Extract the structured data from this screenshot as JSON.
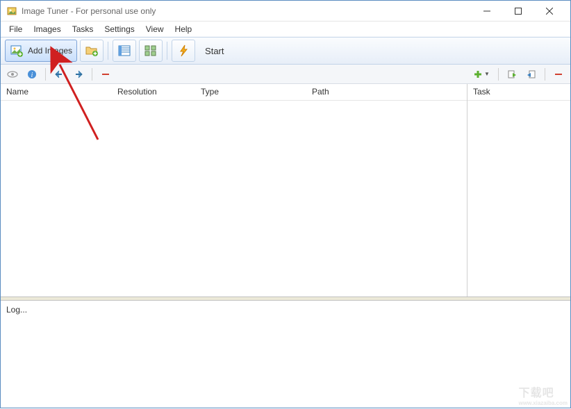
{
  "window": {
    "title": "Image Tuner - For personal use only"
  },
  "menubar": {
    "file": "File",
    "images": "Images",
    "tasks": "Tasks",
    "settings": "Settings",
    "view": "View",
    "help": "Help"
  },
  "toolbar": {
    "add_images": "Add Images",
    "start": "Start"
  },
  "columns": {
    "name": "Name",
    "resolution": "Resolution",
    "type": "Type",
    "path": "Path",
    "task": "Task"
  },
  "log": {
    "label": "Log..."
  },
  "watermark": {
    "text": "下载吧",
    "url": "www.xiazaiba.com"
  }
}
